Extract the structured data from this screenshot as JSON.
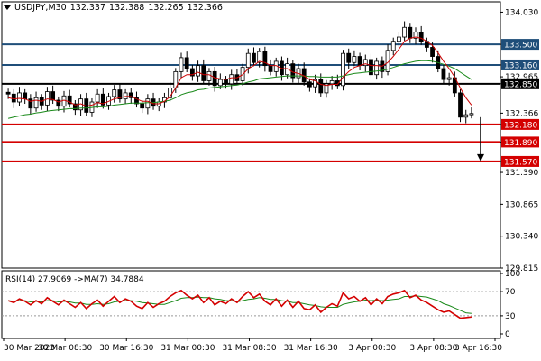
{
  "header": {
    "symbol": "USDJPY,M30",
    "open": "132.337",
    "high": "132.388",
    "low": "132.265",
    "close": "132.366"
  },
  "rsi_header": {
    "label": "RSI(14) 27.9069",
    "ma_label": "->MA(7) 34.7884"
  },
  "colors": {
    "blue_level": "#1f4e79",
    "black_level": "#000000",
    "red_level": "#d40000",
    "ma_red": "#cc0000",
    "ma_green": "#1a8a1a",
    "rsi_line": "#d40000",
    "rsi_ma": "#1a8a1a",
    "arrow": "#000000"
  },
  "chart_data": {
    "type": "candlestick",
    "price_axis": {
      "ticks": [
        "134.030",
        "133.500",
        "133.160",
        "132.965",
        "132.850",
        "132.366",
        "132.180",
        "131.890",
        "131.570",
        "131.390",
        "130.865",
        "130.340",
        "129.815"
      ],
      "range": [
        129.815,
        134.2
      ]
    },
    "time_axis": {
      "labels": [
        "30 Mar 2023",
        "30 Mar 08:30",
        "30 Mar 16:30",
        "31 Mar 00:30",
        "31 Mar 08:30",
        "31 Mar 16:30",
        "3 Apr 00:30",
        "3 Apr 08:30",
        "3 Apr 16:30"
      ]
    },
    "levels": [
      {
        "price": 133.5,
        "label": "133.500",
        "color": "blue"
      },
      {
        "price": 133.16,
        "label": "133.160",
        "color": "blue"
      },
      {
        "price": 132.85,
        "label": "132.850",
        "color": "black"
      },
      {
        "price": 132.18,
        "label": "132.180",
        "color": "red"
      },
      {
        "price": 131.89,
        "label": "131.890",
        "color": "red"
      },
      {
        "price": 131.57,
        "label": "131.570",
        "color": "red"
      }
    ],
    "current_price": 132.366,
    "closes": [
      132.68,
      132.55,
      132.7,
      132.6,
      132.45,
      132.62,
      132.5,
      132.72,
      132.58,
      132.48,
      132.65,
      132.52,
      132.42,
      132.6,
      132.38,
      132.55,
      132.68,
      132.5,
      132.64,
      132.75,
      132.6,
      132.7,
      132.62,
      132.52,
      132.45,
      132.6,
      132.48,
      132.55,
      132.62,
      132.78,
      133.05,
      133.28,
      133.1,
      132.98,
      133.15,
      132.9,
      133.05,
      132.82,
      132.92,
      132.85,
      133.0,
      132.9,
      133.12,
      133.35,
      133.2,
      133.38,
      133.15,
      133.05,
      133.22,
      133.0,
      133.18,
      132.95,
      133.1,
      132.88,
      132.8,
      132.92,
      132.7,
      132.85,
      132.9,
      132.82,
      133.35,
      133.2,
      133.3,
      133.15,
      133.25,
      133.0,
      133.22,
      133.05,
      133.4,
      133.55,
      133.62,
      133.78,
      133.6,
      133.7,
      133.55,
      133.45,
      133.3,
      133.1,
      132.92,
      132.95,
      132.7,
      132.3,
      132.34,
      132.36
    ],
    "ma_fast": [
      132.62,
      132.6,
      132.61,
      132.6,
      132.56,
      132.58,
      132.56,
      132.6,
      132.59,
      132.55,
      132.58,
      132.55,
      132.5,
      132.52,
      132.48,
      132.5,
      132.54,
      132.52,
      132.56,
      132.6,
      132.62,
      132.64,
      132.64,
      132.6,
      132.56,
      132.56,
      132.52,
      132.52,
      132.56,
      132.64,
      132.78,
      132.95,
      133.0,
      133.0,
      133.04,
      133.0,
      133.0,
      132.95,
      132.93,
      132.92,
      132.95,
      132.95,
      133.0,
      133.1,
      133.15,
      133.22,
      133.2,
      133.15,
      133.15,
      133.1,
      133.1,
      133.04,
      133.02,
      132.98,
      132.92,
      132.9,
      132.84,
      132.82,
      132.84,
      132.84,
      132.96,
      133.05,
      133.12,
      133.15,
      133.18,
      133.15,
      133.15,
      133.14,
      133.2,
      133.3,
      133.42,
      133.55,
      133.6,
      133.62,
      133.6,
      133.55,
      133.48,
      133.36,
      133.22,
      133.1,
      132.96,
      132.78,
      132.62,
      132.5
    ],
    "ma_slow": [
      132.28,
      132.3,
      132.32,
      132.34,
      132.35,
      132.37,
      132.38,
      132.4,
      132.41,
      132.42,
      132.43,
      132.44,
      132.44,
      132.45,
      132.45,
      132.46,
      132.47,
      132.47,
      132.48,
      132.5,
      132.51,
      132.52,
      132.53,
      132.53,
      132.53,
      132.54,
      132.54,
      132.55,
      132.56,
      132.58,
      132.62,
      132.67,
      132.7,
      132.72,
      132.75,
      132.76,
      132.78,
      132.79,
      132.8,
      132.81,
      132.82,
      132.83,
      132.85,
      132.88,
      132.9,
      132.93,
      132.94,
      132.95,
      132.96,
      132.97,
      132.98,
      132.98,
      132.98,
      132.98,
      132.97,
      132.97,
      132.96,
      132.96,
      132.96,
      132.96,
      132.98,
      133.0,
      133.02,
      133.03,
      133.04,
      133.05,
      133.06,
      133.07,
      133.09,
      133.12,
      133.15,
      133.18,
      133.2,
      133.22,
      133.23,
      133.23,
      133.22,
      133.2,
      133.17,
      133.14,
      133.1,
      133.04,
      132.98,
      132.92
    ],
    "rsi": {
      "name": "RSI(14)",
      "value": 27.9069,
      "ma_name": "MA(7)",
      "ma_value": 34.7884,
      "ticks": [
        "100",
        "70",
        "30",
        "0"
      ],
      "range": [
        0,
        100
      ],
      "levels": [
        70,
        30
      ],
      "values": [
        55,
        52,
        58,
        54,
        48,
        55,
        50,
        60,
        54,
        48,
        56,
        50,
        44,
        52,
        42,
        50,
        56,
        46,
        54,
        62,
        52,
        58,
        54,
        46,
        42,
        52,
        44,
        50,
        54,
        62,
        68,
        72,
        64,
        58,
        64,
        52,
        60,
        48,
        54,
        50,
        58,
        52,
        62,
        70,
        60,
        66,
        54,
        48,
        58,
        46,
        56,
        44,
        54,
        42,
        40,
        48,
        36,
        44,
        50,
        46,
        68,
        58,
        62,
        54,
        60,
        48,
        58,
        50,
        62,
        66,
        68,
        72,
        60,
        64,
        56,
        52,
        46,
        40,
        36,
        38,
        32,
        26,
        27,
        28
      ],
      "ma_values": [
        55,
        54,
        55,
        55,
        53,
        54,
        53,
        55,
        55,
        53,
        54,
        53,
        51,
        51,
        49,
        49,
        50,
        49,
        50,
        53,
        54,
        55,
        55,
        54,
        52,
        51,
        50,
        49,
        49,
        52,
        55,
        59,
        60,
        60,
        61,
        60,
        60,
        58,
        57,
        55,
        55,
        53,
        55,
        57,
        58,
        60,
        59,
        57,
        57,
        55,
        54,
        52,
        52,
        50,
        48,
        47,
        45,
        44,
        44,
        44,
        49,
        51,
        53,
        54,
        56,
        55,
        56,
        55,
        56,
        57,
        58,
        62,
        62,
        63,
        62,
        61,
        58,
        55,
        50,
        47,
        43,
        39,
        35,
        34
      ]
    }
  }
}
